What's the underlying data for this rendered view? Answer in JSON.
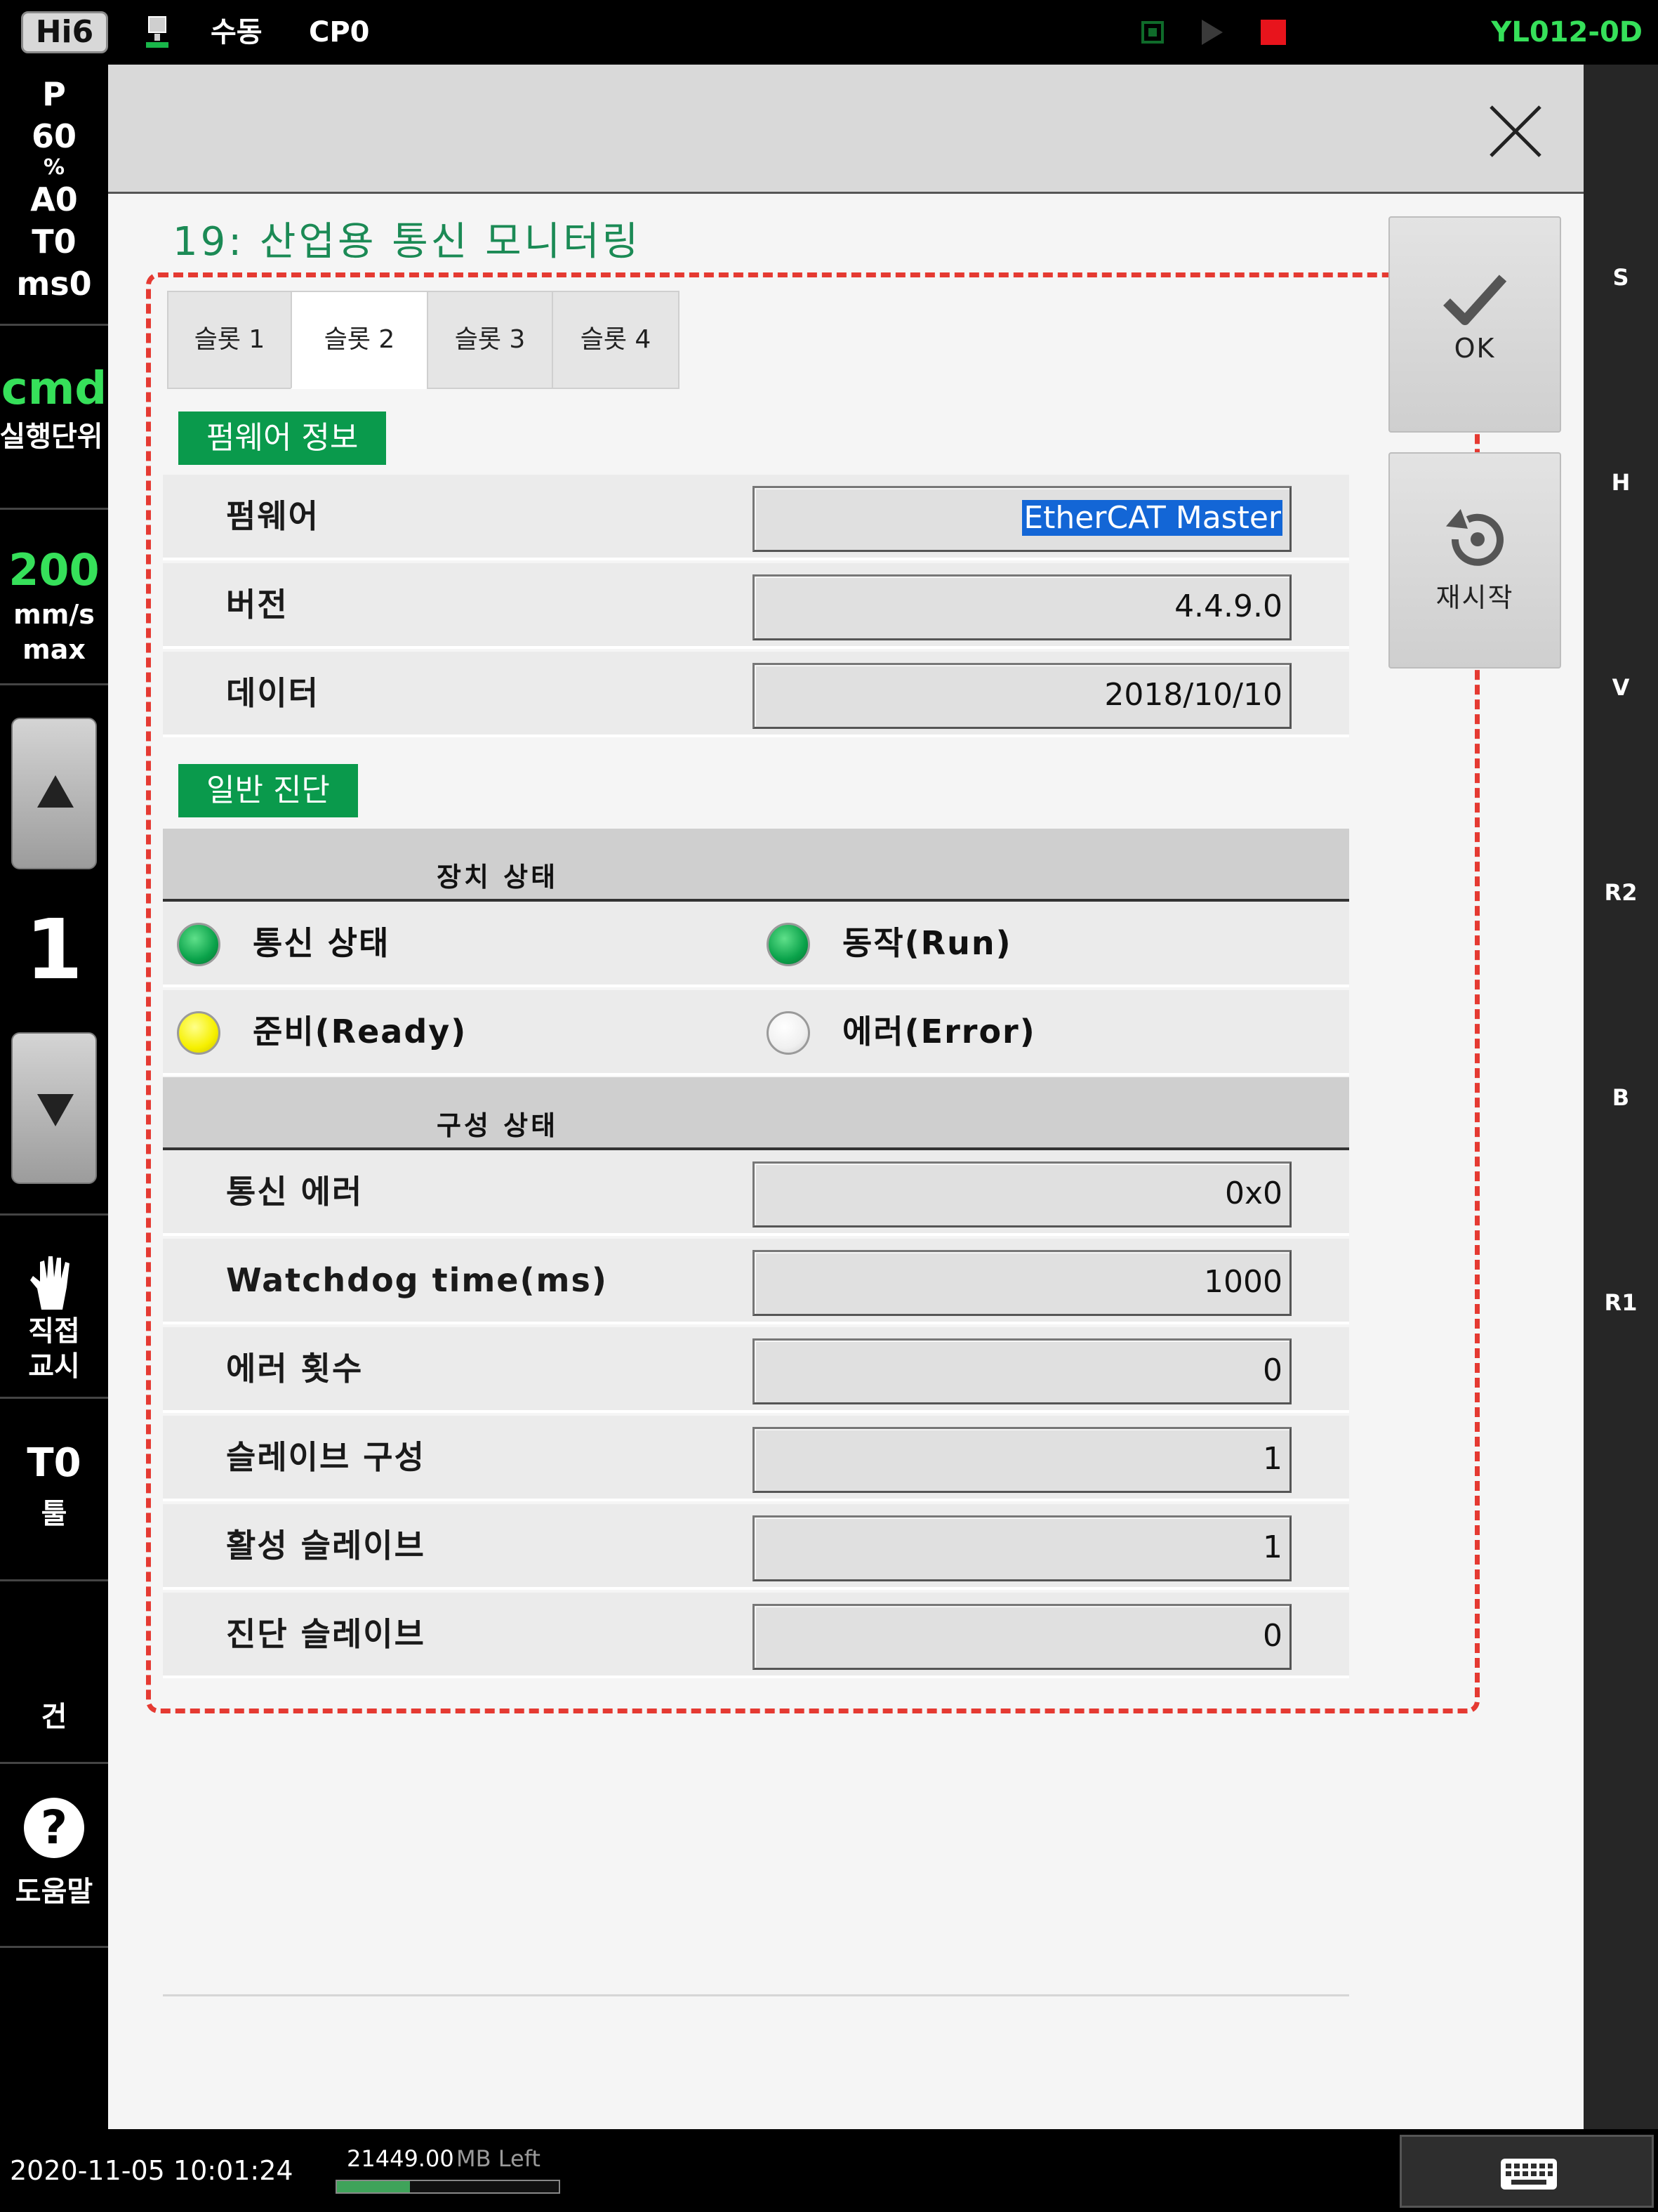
{
  "topbar": {
    "logo": "Hi6",
    "mode": "수동",
    "cp": "CP0",
    "model": "YL012-0D",
    "icons": {
      "network": "network-pc-icon",
      "stop": "stop-indicator",
      "play": "play-indicator",
      "record": "record-indicator"
    },
    "colors": {
      "model": "#36e05a",
      "record": "#e8141c"
    }
  },
  "left_panel": {
    "status": {
      "p": "P",
      "p_value": "60",
      "percent": "%",
      "a": "A0",
      "t": "T0",
      "ms": "ms0"
    },
    "cmd": {
      "label": "cmd",
      "unit": "실행단위"
    },
    "speed": {
      "value": "200",
      "unit": "mm/s",
      "max": "max"
    },
    "step_value": "1",
    "direct_teach": {
      "line1": "직접",
      "line2": "교시",
      "icon": "hand-icon"
    },
    "tool": {
      "label": "T0",
      "sub": "툴"
    },
    "gun": {
      "label": "건"
    },
    "help": {
      "icon_glyph": "?",
      "label": "도움말"
    }
  },
  "right_rail": {
    "labels": [
      "S",
      "H",
      "V",
      "R2",
      "B",
      "R1"
    ]
  },
  "dialog": {
    "title": "19: 산업용 통신 모니터링",
    "tabs": [
      {
        "label": "슬롯 1",
        "active": false
      },
      {
        "label": "슬롯 2",
        "active": true
      },
      {
        "label": "슬롯 3",
        "active": false
      },
      {
        "label": "슬롯 4",
        "active": false
      }
    ],
    "firmware_section": {
      "badge": "펌웨어 정보",
      "rows": [
        {
          "label": "펌웨어",
          "value": "EtherCAT Master"
        },
        {
          "label": "버전",
          "value": "4.4.9.0"
        },
        {
          "label": "데이터",
          "value": "2018/10/10"
        }
      ]
    },
    "diag_section": {
      "badge": "일반 진단",
      "device_status": {
        "header": "장치 상태",
        "leds": [
          {
            "label": "통신 상태",
            "state": "green"
          },
          {
            "label": "동작(Run)",
            "state": "green"
          },
          {
            "label": "준비(Ready)",
            "state": "yellow"
          },
          {
            "label": "에러(Error)",
            "state": "off"
          }
        ]
      },
      "config_status": {
        "header": "구성 상태",
        "rows": [
          {
            "label": "통신 에러",
            "value": "0x0"
          },
          {
            "label": "Watchdog time(ms)",
            "value": "1000"
          },
          {
            "label": "에러 횟수",
            "value": "0"
          },
          {
            "label": "슬레이브 구성",
            "value": "1"
          },
          {
            "label": "활성 슬레이브",
            "value": "1"
          },
          {
            "label": "진단 슬레이브",
            "value": "0"
          }
        ]
      }
    },
    "buttons": {
      "ok": "OK",
      "restart": "재시작"
    }
  },
  "statusbar": {
    "datetime": "2020-11-05 10:01:24",
    "memory_value": "21449.00",
    "memory_unit": "MB Left",
    "memory_fill_fraction": 0.33
  },
  "colors": {
    "accent_green": "#0a9a4c",
    "title_green": "#1b8a55",
    "dashed_frame": "#e53a32",
    "selection_blue": "#1366d6"
  }
}
